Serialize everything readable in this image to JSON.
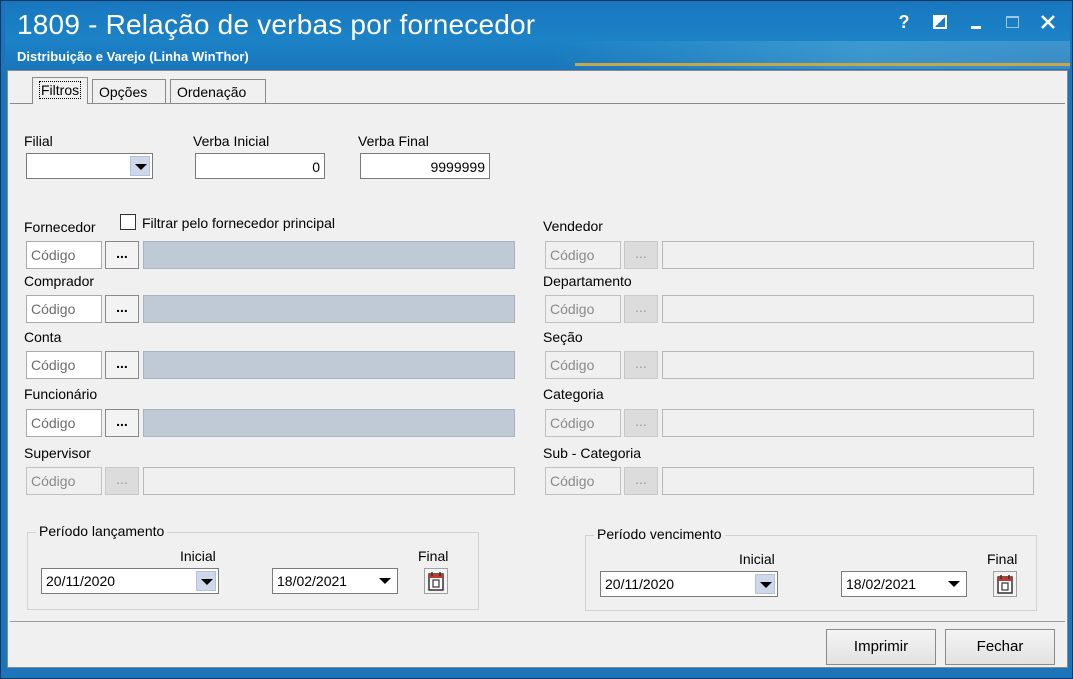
{
  "window": {
    "title": "1809 - Relação de verbas por fornecedor",
    "subtitle": "Distribuição e Varejo (Linha WinThor)",
    "help": "?"
  },
  "tabs": [
    {
      "label": "Filtros",
      "active": true
    },
    {
      "label": "Opções",
      "active": false
    },
    {
      "label": "Ordenação",
      "active": false
    }
  ],
  "filial": {
    "label": "Filial",
    "value": ""
  },
  "verba_inicial": {
    "label": "Verba Inicial",
    "value": "0"
  },
  "verba_final": {
    "label": "Verba Final",
    "value": "9999999"
  },
  "filtrar_fornecedor_principal": {
    "label": "Filtrar pelo fornecedor principal",
    "checked": false
  },
  "code_placeholder": "Código",
  "ellipsis": "...",
  "left_fields": [
    {
      "label": "Fornecedor",
      "enabled": true
    },
    {
      "label": "Comprador",
      "enabled": true
    },
    {
      "label": "Conta",
      "enabled": true
    },
    {
      "label": "Funcionário",
      "enabled": true
    },
    {
      "label": "Supervisor",
      "enabled": false
    }
  ],
  "right_fields": [
    {
      "label": "Vendedor",
      "enabled": false
    },
    {
      "label": "Departamento",
      "enabled": false
    },
    {
      "label": "Seção",
      "enabled": false
    },
    {
      "label": "Categoria",
      "enabled": false
    },
    {
      "label": "Sub - Categoria",
      "enabled": false
    }
  ],
  "periodo_lancamento": {
    "legend": "Período lançamento",
    "inicial_label": "Inicial",
    "final_label": "Final",
    "inicial": "20/11/2020",
    "final": "18/02/2021"
  },
  "periodo_vencimento": {
    "legend": "Período vencimento",
    "inicial_label": "Inicial",
    "final_label": "Final",
    "inicial": "20/11/2020",
    "final": "18/02/2021"
  },
  "buttons": {
    "imprimir": "Imprimir",
    "fechar": "Fechar"
  }
}
